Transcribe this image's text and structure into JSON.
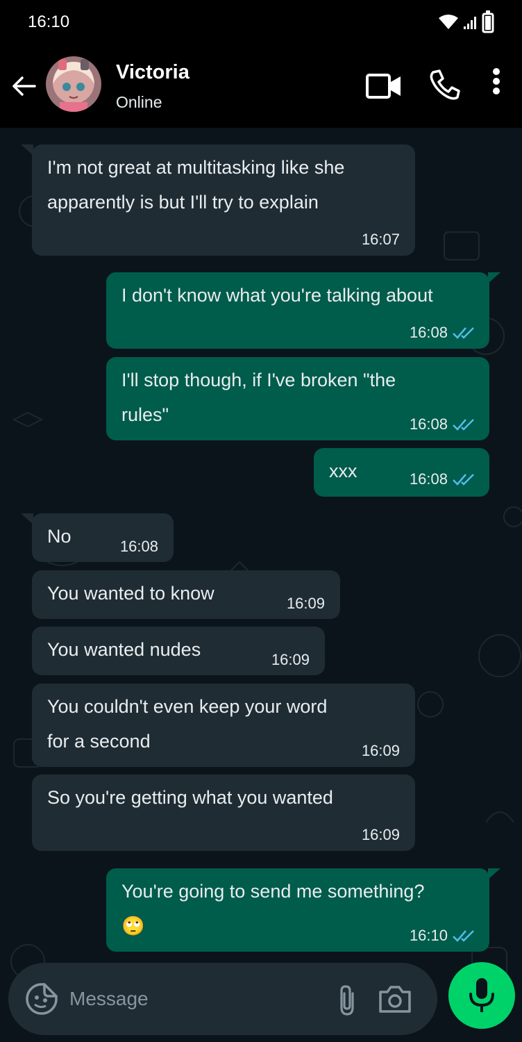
{
  "status_bar": {
    "time": "16:10"
  },
  "header": {
    "name": "Victoria",
    "status": "Online"
  },
  "messages": [
    {
      "dir": "in",
      "text": "I'm not great at multitasking like she\napparently is but I'll try to explain",
      "time": "16:07"
    },
    {
      "dir": "out",
      "text": "I don't know what you're talking about",
      "time": "16:08"
    },
    {
      "dir": "out",
      "text": "I'll stop though, if I've broken \"the\nrules\"",
      "time": "16:08"
    },
    {
      "dir": "out",
      "text": "xxx",
      "time": "16:08"
    },
    {
      "dir": "in",
      "text": "No",
      "time": "16:08"
    },
    {
      "dir": "in",
      "text": "You wanted to know",
      "time": "16:09"
    },
    {
      "dir": "in",
      "text": "You wanted nudes",
      "time": "16:09"
    },
    {
      "dir": "in",
      "text": "You couldn't even keep your word\nfor a second",
      "time": "16:09"
    },
    {
      "dir": "in",
      "text": "So you're getting what you wanted",
      "time": "16:09"
    },
    {
      "dir": "out",
      "text": "You're going to send me something?\n🙄",
      "time": "16:10"
    }
  ],
  "composer": {
    "placeholder": "Message"
  },
  "colors": {
    "incoming": "#1f2c34",
    "outgoing": "#005c4b",
    "read_tick": "#53bdeb",
    "mic": "#00d26a"
  }
}
